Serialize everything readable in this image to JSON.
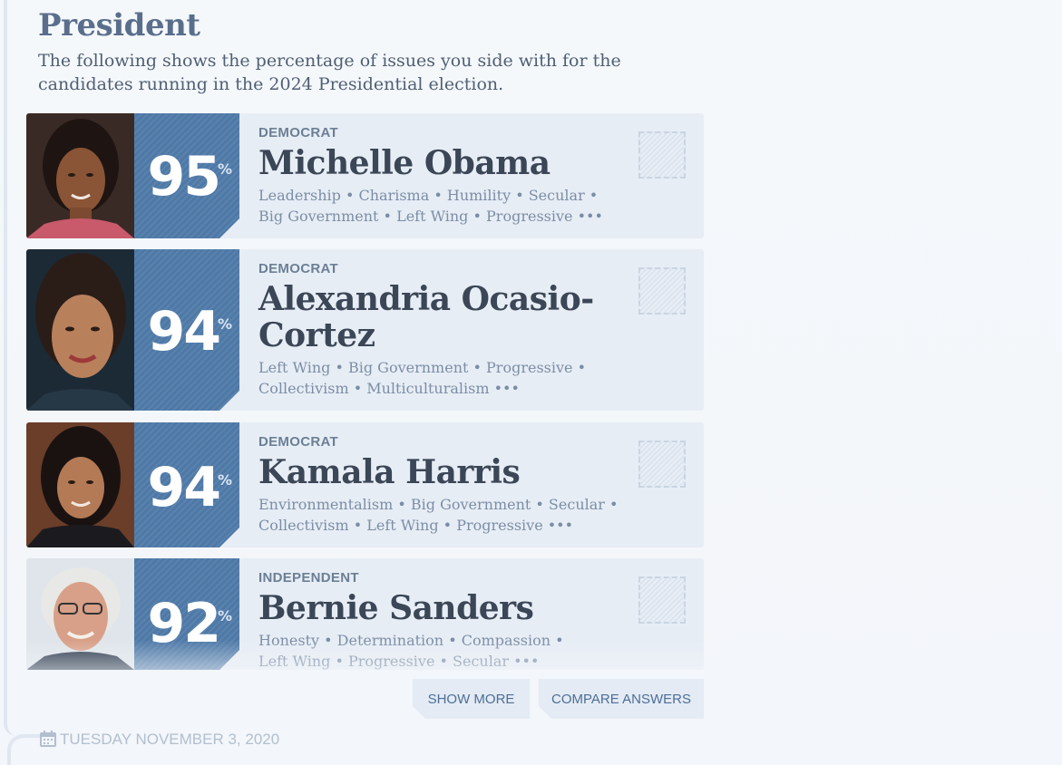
{
  "page": {
    "title": "President",
    "subtitle": "The following shows the percentage of issues you side with for the candidates running in the 2024 Presidential election."
  },
  "candidates": [
    {
      "party": "DEMOCRAT",
      "name": "Michelle Obama",
      "percent": "95",
      "percent_sign": "%",
      "tags_line1": "Leadership • Charisma • Humility • Secular •",
      "tags_line2": "Big Government • Left Wing • Progressive •••"
    },
    {
      "party": "DEMOCRAT",
      "name": "Alexandria Ocasio-Cortez",
      "name_line1": "Alexandria Ocasio-",
      "name_line2": "Cortez",
      "percent": "94",
      "percent_sign": "%",
      "tags_line1": "Left Wing • Big Government • Progressive •",
      "tags_line2": "Collectivism • Multiculturalism •••"
    },
    {
      "party": "DEMOCRAT",
      "name": "Kamala Harris",
      "percent": "94",
      "percent_sign": "%",
      "tags_line1": "Environmentalism • Big Government • Secular •",
      "tags_line2": "Collectivism • Left Wing • Progressive •••"
    },
    {
      "party": "INDEPENDENT",
      "name": "Bernie Sanders",
      "percent": "92",
      "percent_sign": "%",
      "tags_line1": "Honesty • Determination • Compassion •",
      "tags_line2": "Left Wing • Progressive • Secular •••"
    }
  ],
  "buttons": {
    "show_more": "SHOW MORE",
    "compare_answers": "COMPARE ANSWERS"
  },
  "footer": {
    "date": "TUESDAY NOVEMBER 3, 2020"
  },
  "icons": {
    "calendar": "calendar-icon",
    "checkbox": "checkbox-icon"
  },
  "colors": {
    "accent": "#4e79a7",
    "title": "#5a6e8c",
    "name": "#3b4656",
    "tags": "#7b8ea6",
    "row_bg": "#e7edf5"
  }
}
